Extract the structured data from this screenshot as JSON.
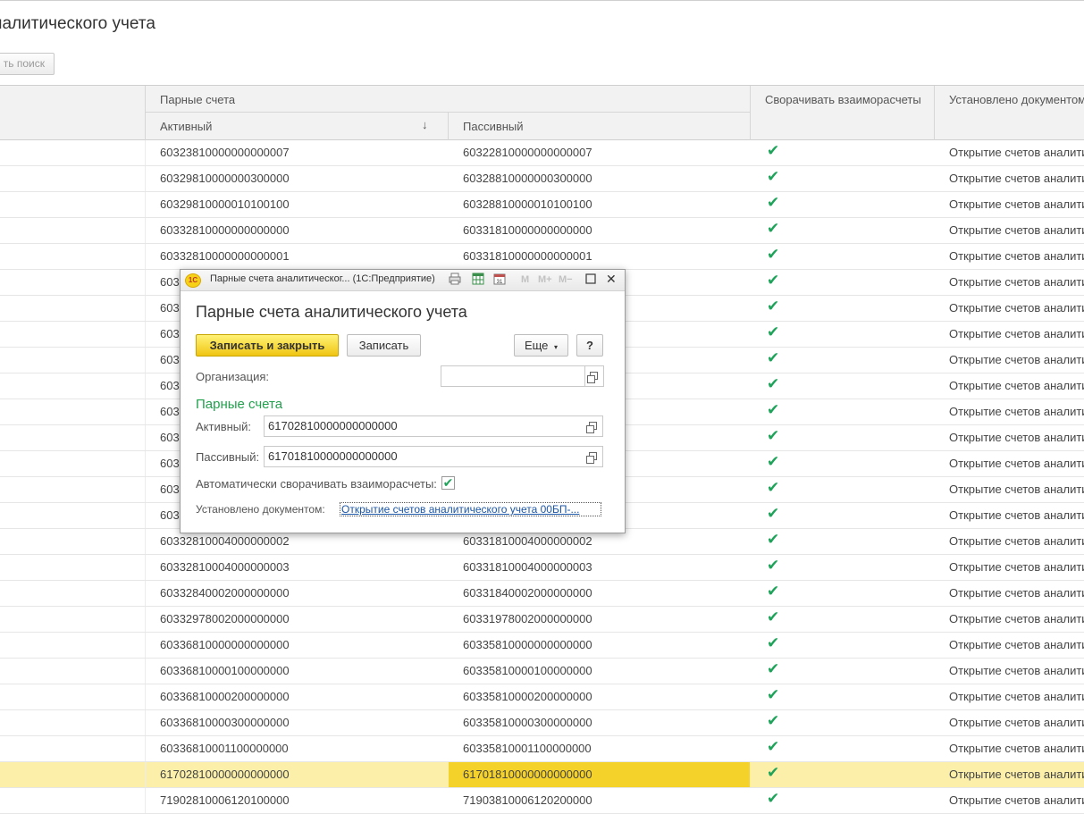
{
  "page": {
    "title": "налитического учета",
    "search_button": "ть поиск"
  },
  "table": {
    "group_header": "Парные счета",
    "col_active": "Активный",
    "col_passive": "Пассивный",
    "col_collapse": "Сворачивать взаиморасчеты",
    "col_document": "Установлено документом",
    "rows": [
      {
        "active": "60323810000000000007",
        "passive": "60322810000000000007",
        "collapse": true,
        "doc": "Открытие счетов аналитического учета",
        "selected": false
      },
      {
        "active": "60329810000000300000",
        "passive": "60328810000000300000",
        "collapse": true,
        "doc": "Открытие счетов аналитического учета",
        "selected": false
      },
      {
        "active": "60329810000010100100",
        "passive": "60328810000010100100",
        "collapse": true,
        "doc": "Открытие счетов аналитического учета",
        "selected": false
      },
      {
        "active": "60332810000000000000",
        "passive": "60331810000000000000",
        "collapse": true,
        "doc": "Открытие счетов аналитического учета",
        "selected": false
      },
      {
        "active": "60332810000000000001",
        "passive": "60331810000000000001",
        "collapse": true,
        "doc": "Открытие счетов аналитического учета",
        "selected": false
      },
      {
        "active": "603",
        "passive": "",
        "collapse": true,
        "doc": "Открытие счетов аналитического учета",
        "selected": false
      },
      {
        "active": "603",
        "passive": "",
        "collapse": true,
        "doc": "Открытие счетов аналитического учета",
        "selected": false
      },
      {
        "active": "603",
        "passive": "",
        "collapse": true,
        "doc": "Открытие счетов аналитического учета",
        "selected": false
      },
      {
        "active": "603",
        "passive": "",
        "collapse": true,
        "doc": "Открытие счетов аналитического учета",
        "selected": false
      },
      {
        "active": "603",
        "passive": "",
        "collapse": true,
        "doc": "Открытие счетов аналитического учета",
        "selected": false
      },
      {
        "active": "603",
        "passive": "",
        "collapse": true,
        "doc": "Открытие счетов аналитического учета",
        "selected": false
      },
      {
        "active": "603",
        "passive": "",
        "collapse": true,
        "doc": "Открытие счетов аналитического учета",
        "selected": false
      },
      {
        "active": "603",
        "passive": "",
        "collapse": true,
        "doc": "Открытие счетов аналитического учета",
        "selected": false
      },
      {
        "active": "603",
        "passive": "",
        "collapse": true,
        "doc": "Открытие счетов аналитического учета",
        "selected": false
      },
      {
        "active": "603",
        "passive": "",
        "collapse": true,
        "doc": "Открытие счетов аналитического учета",
        "selected": false
      },
      {
        "active": "60332810004000000002",
        "passive": "60331810004000000002",
        "collapse": true,
        "doc": "Открытие счетов аналитического учета",
        "selected": false
      },
      {
        "active": "60332810004000000003",
        "passive": "60331810004000000003",
        "collapse": true,
        "doc": "Открытие счетов аналитического учета",
        "selected": false
      },
      {
        "active": "60332840002000000000",
        "passive": "60331840002000000000",
        "collapse": true,
        "doc": "Открытие счетов аналитического учета",
        "selected": false
      },
      {
        "active": "60332978002000000000",
        "passive": "60331978002000000000",
        "collapse": true,
        "doc": "Открытие счетов аналитического учета",
        "selected": false
      },
      {
        "active": "60336810000000000000",
        "passive": "60335810000000000000",
        "collapse": true,
        "doc": "Открытие счетов аналитического учета",
        "selected": false
      },
      {
        "active": "60336810000100000000",
        "passive": "60335810000100000000",
        "collapse": true,
        "doc": "Открытие счетов аналитического учета",
        "selected": false
      },
      {
        "active": "60336810000200000000",
        "passive": "60335810000200000000",
        "collapse": true,
        "doc": "Открытие счетов аналитического учета",
        "selected": false
      },
      {
        "active": "60336810000300000000",
        "passive": "60335810000300000000",
        "collapse": true,
        "doc": "Открытие счетов аналитического учета",
        "selected": false
      },
      {
        "active": "60336810001100000000",
        "passive": "60335810001100000000",
        "collapse": true,
        "doc": "Открытие счетов аналитического учета",
        "selected": false
      },
      {
        "active": "61702810000000000000",
        "passive": "61701810000000000000",
        "collapse": true,
        "doc": "Открытие счетов аналитического учета",
        "selected": true
      },
      {
        "active": "71902810006120100000",
        "passive": "71903810006120200000",
        "collapse": true,
        "doc": "Открытие счетов аналитического учета",
        "selected": false
      }
    ]
  },
  "dialog": {
    "window_title": "Парные счета аналитическог...  (1С:Предприятие)",
    "heading": "Парные счета аналитического учета",
    "btn_save_close": "Записать и закрыть",
    "btn_save": "Записать",
    "btn_more": "Еще",
    "btn_help": "?",
    "org_label": "Организация:",
    "org_value": "",
    "section_title": "Парные счета",
    "active_label": "Активный:",
    "active_value": "61702810000000000000",
    "passive_label": "Пассивный:",
    "passive_value": "61701810000000000000",
    "auto_collapse_label": "Автоматически сворачивать взаиморасчеты:",
    "auto_collapse": true,
    "document_label": "Установлено документом:",
    "document_link": "Открытие счетов аналитического учета 00БП-...",
    "logo_text": "1С",
    "tb_calc": "31",
    "tb_m": "M",
    "tb_mplus": "M+",
    "tb_mminus": "M−",
    "tb_close": "✕"
  },
  "colors": {
    "accent_green": "#22a14d",
    "selected_row": "#fbefa9",
    "selected_cell": "#f5d22a",
    "primary_button": "#f7d117"
  }
}
